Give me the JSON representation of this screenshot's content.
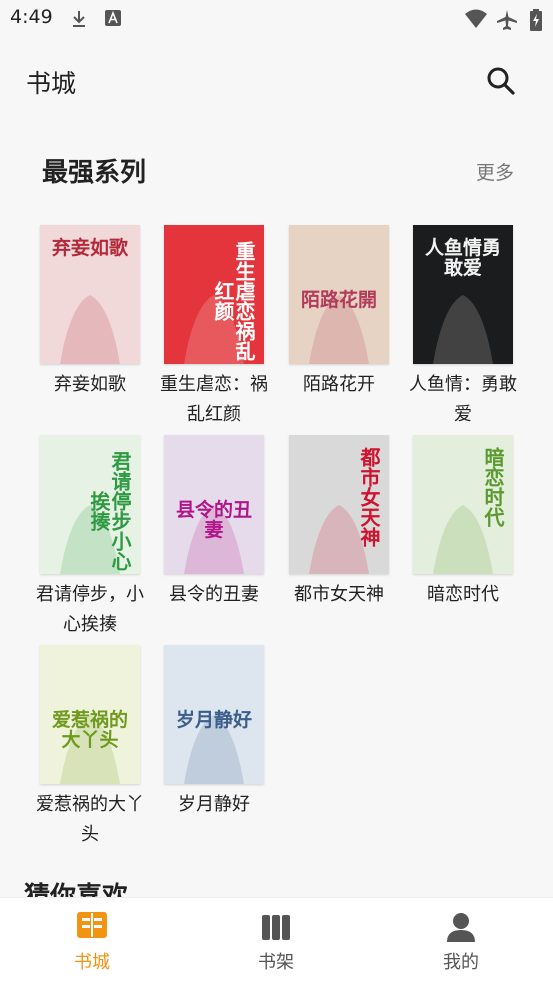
{
  "status": {
    "time": "4:49",
    "icons": [
      "download-icon",
      "keyboard-a-icon",
      "wifi-icon",
      "airplane-icon",
      "battery-charging-icon"
    ]
  },
  "app_bar": {
    "title": "书城",
    "search_icon": "search-icon"
  },
  "section": {
    "title": "最强系列",
    "more": "更多"
  },
  "books": [
    {
      "title": "弃妾如歌",
      "cover_text": "弃妾如歌",
      "cover_color": "#f1d9da",
      "ink": "#b2293a"
    },
    {
      "title": "重生虐恋：祸乱红颜",
      "cover_text": "重生虐恋祸乱红颜",
      "cover_color": "#e3353b",
      "ink": "#ffffff"
    },
    {
      "title": "陌路花开",
      "cover_text": "陌路花開",
      "cover_color": "#e7d3c3",
      "ink": "#b23a5a"
    },
    {
      "title": "人鱼情：勇敢爱",
      "cover_text": "人鱼情勇敢爱",
      "cover_color": "#1b1c1d",
      "ink": "#f2f2f2"
    },
    {
      "title": "君请停步，小心挨揍",
      "cover_text": "君请停步小心挨揍",
      "cover_color": "#e6f2e3",
      "ink": "#2f9a44"
    },
    {
      "title": "县令的丑妻",
      "cover_text": "县令的丑妻",
      "cover_color": "#e6dbea",
      "ink": "#b0168a"
    },
    {
      "title": "都市女天神",
      "cover_text": "都市女天神",
      "cover_color": "#d9d9d9",
      "ink": "#d0122e"
    },
    {
      "title": "暗恋时代",
      "cover_text": "暗恋时代",
      "cover_color": "#e4eedd",
      "ink": "#5a9a2e"
    },
    {
      "title": "爱惹祸的大丫头",
      "cover_text": "爱惹祸的大丫头",
      "cover_color": "#f0f3dc",
      "ink": "#6e9a1e"
    },
    {
      "title": "岁月静好",
      "cover_text": "岁月静好",
      "cover_color": "#dde6ef",
      "ink": "#3b5e8c"
    }
  ],
  "guess": {
    "title": "猜你喜欢"
  },
  "nav": {
    "items": [
      {
        "label": "书城",
        "icon": "bookstore-icon",
        "active": true
      },
      {
        "label": "书架",
        "icon": "bookshelf-icon",
        "active": false
      },
      {
        "label": "我的",
        "icon": "profile-icon",
        "active": false
      }
    ],
    "active_color": "#f29411",
    "inactive_color": "#555555"
  }
}
